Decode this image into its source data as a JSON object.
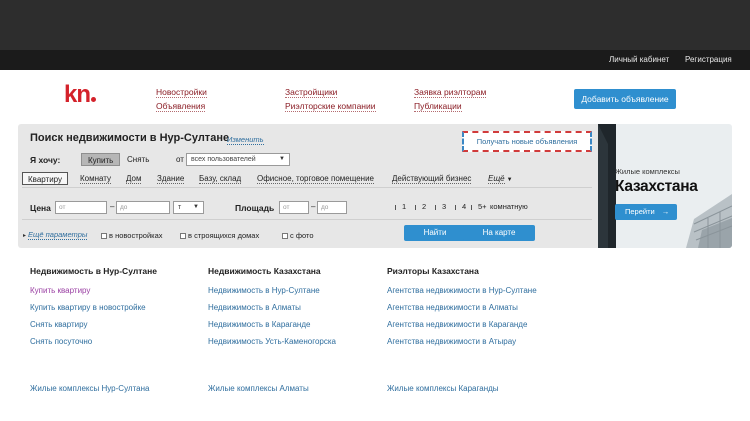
{
  "userbar": {
    "cabinet": "Личный кабинет",
    "register": "Регистрация"
  },
  "logo": {
    "text": "kn"
  },
  "nav": {
    "col1": [
      "Новостройки",
      "Объявления"
    ],
    "col2": [
      "Застройщики",
      "Риэлторские компании"
    ],
    "col3": [
      "Заявка риэлторам",
      "Публикации"
    ],
    "add_button": "Добавить объявление"
  },
  "search": {
    "title": "Поиск недвижимости в Нур-Султане",
    "change_link": "Изменить",
    "subscribe": "Получать новые объявления",
    "want_label": "Я хочу:",
    "buy": "Купить",
    "rent": "Снять",
    "from_label": "от",
    "from_value": "всех пользователей",
    "property_types": [
      "Квартиру",
      "Комнату",
      "Дом",
      "Здание",
      "Базу, склад",
      "Офисное, торговое помещение",
      "Действующий бизнес"
    ],
    "more_types": "Ещё",
    "price_label": "Цена",
    "from_placeholder": "от",
    "to_placeholder": "до",
    "currency": "т",
    "area_label": "Площадь",
    "area_from_placeholder": "от",
    "area_to_placeholder": "до",
    "rooms": [
      "1",
      "2",
      "3",
      "4",
      "5+"
    ],
    "rooms_suffix": "комнатную",
    "more_params": "Ещё параметры",
    "checks": [
      "в новостройках",
      "в строящихся домах",
      "с фото"
    ],
    "find_button": "Найти",
    "map_button": "На карте"
  },
  "promo": {
    "label": "Жилые комплексы",
    "headline": "Казахстана",
    "button": "Перейти"
  },
  "footer": {
    "col1": {
      "heading": "Недвижимость в Нур-Султане",
      "links": [
        "Купить квартиру",
        "Купить квартиру в новостройке",
        "Снять квартиру",
        "Снять посуточно"
      ],
      "bottom": "Жилые комплексы Нур-Султана"
    },
    "col2": {
      "heading": "Недвижимость Казахстана",
      "links": [
        "Недвижимость в Нур-Султане",
        "Недвижимость в Алматы",
        "Недвижимость в Караганде",
        "Недвижимость Усть-Каменогорска"
      ],
      "bottom": "Жилые комплексы Алматы"
    },
    "col3": {
      "heading": "Риэлторы Казахстана",
      "links": [
        "Агентства недвижимости в Нур-Султане",
        "Агентства недвижимости в Алматы",
        "Агентства недвижимости в Караганде",
        "Агентства недвижимости в Атырау"
      ],
      "bottom": "Жилые комплексы Караганды"
    }
  },
  "colors": {
    "brand_red": "#d4222b",
    "accent_blue": "#2f8fcf",
    "link_blue": "#2f6e9e",
    "nav_red": "#8a1c24"
  }
}
